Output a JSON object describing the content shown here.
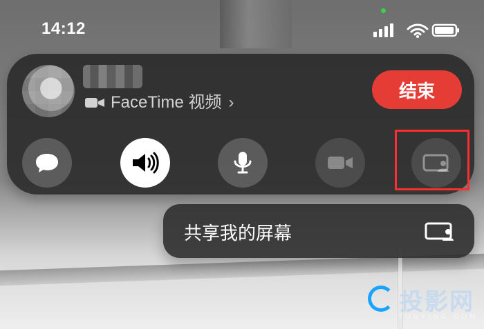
{
  "status_bar": {
    "time": "14:12"
  },
  "facetime_call": {
    "subtitle": "FaceTime 视频",
    "end_button_label": "结束",
    "controls": [
      {
        "name": "messages",
        "icon": "message-bubble-icon"
      },
      {
        "name": "speaker",
        "icon": "speaker-wave-icon"
      },
      {
        "name": "microphone",
        "icon": "mic-icon"
      },
      {
        "name": "video",
        "icon": "video-camera-icon"
      },
      {
        "name": "share_screen",
        "icon": "share-screen-icon"
      }
    ],
    "selected_control": "share_screen"
  },
  "share_menu": {
    "label": "共享我的屏幕",
    "icon": "share-screen-icon"
  },
  "colors": {
    "end_button": "#e53c36",
    "highlight_box": "#ff2f2f",
    "status_dot": "#3ad04b",
    "watermark_ring": "#1aa3ff"
  }
}
